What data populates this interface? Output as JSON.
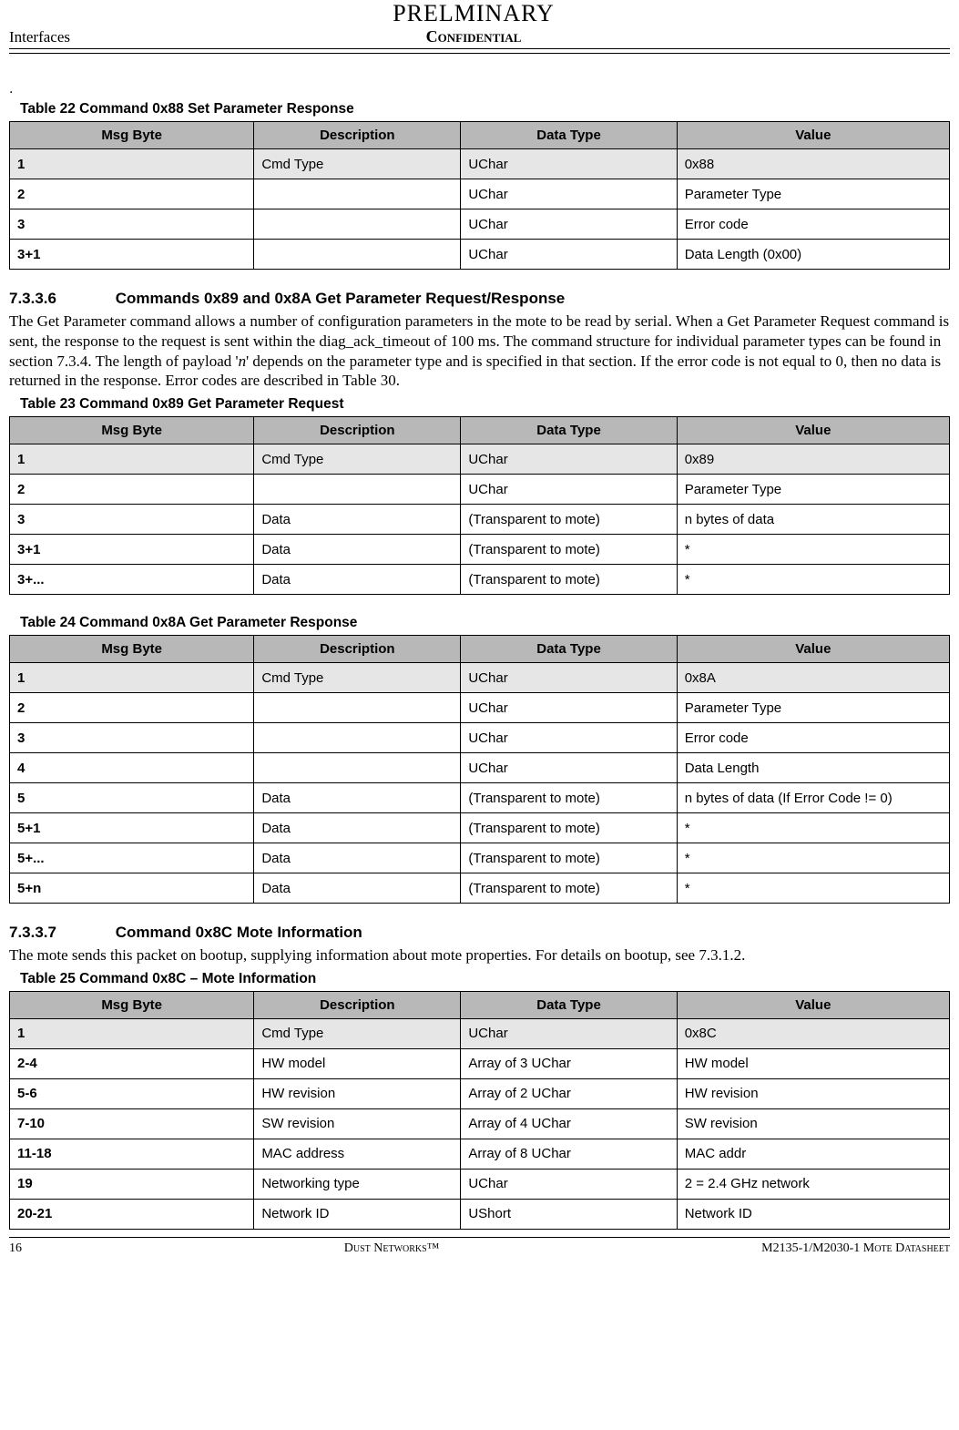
{
  "header": {
    "preliminary": "PRELMINARY",
    "confidential": "Confidential",
    "section": "Interfaces"
  },
  "table22": {
    "caption": "Table 22    Command 0x88 Set Parameter Response",
    "headers": [
      "Msg Byte",
      "Description",
      "Data Type",
      "Value"
    ],
    "rows": [
      {
        "byte": "1",
        "desc": "Cmd Type",
        "type": "UChar",
        "val": "0x88",
        "shaded": true
      },
      {
        "byte": "2",
        "desc": "",
        "type": "UChar",
        "val": "Parameter Type",
        "shaded": false
      },
      {
        "byte": "3",
        "desc": "",
        "type": "UChar",
        "val": "Error code",
        "shaded": false
      },
      {
        "byte": "3+1",
        "desc": "",
        "type": "UChar",
        "val": "Data Length (0x00)",
        "shaded": false
      }
    ]
  },
  "sec7336": {
    "num": "7.3.3.6",
    "title": "Commands 0x89 and 0x8A Get Parameter Request/Response",
    "body": "The Get Parameter command allows a number of configuration parameters in the mote to be read by serial. When a Get Parameter Request command is sent, the response to the request is sent within the diag_ack_timeout of 100 ms. The command structure for individual parameter types can be found in section 7.3.4. The length of payload 'n' depends on the parameter type and is specified in that section. If the error code is not equal to 0, then no data is returned in the response. Error codes are described in Table 30."
  },
  "table23": {
    "caption": "Table 23    Command 0x89 Get Parameter Request",
    "headers": [
      "Msg Byte",
      "Description",
      "Data Type",
      "Value"
    ],
    "rows": [
      {
        "byte": "1",
        "desc": "Cmd Type",
        "type": "UChar",
        "val": "0x89",
        "shaded": true
      },
      {
        "byte": "2",
        "desc": "",
        "type": "UChar",
        "val": "Parameter Type",
        "shaded": false
      },
      {
        "byte": "3",
        "desc": "Data",
        "type": "(Transparent to mote)",
        "val": "n bytes of data",
        "shaded": false
      },
      {
        "byte": "3+1",
        "desc": "Data",
        "type": "(Transparent to mote)",
        "val": "*",
        "shaded": false
      },
      {
        "byte": "3+...",
        "desc": "Data",
        "type": "(Transparent to mote)",
        "val": "*",
        "shaded": false
      }
    ]
  },
  "table24": {
    "caption": "Table 24    Command 0x8A Get Parameter Response",
    "headers": [
      "Msg Byte",
      "Description",
      "Data Type",
      "Value"
    ],
    "rows": [
      {
        "byte": "1",
        "desc": "Cmd Type",
        "type": "UChar",
        "val": "0x8A",
        "shaded": true
      },
      {
        "byte": "2",
        "desc": "",
        "type": "UChar",
        "val": "Parameter Type",
        "shaded": false
      },
      {
        "byte": "3",
        "desc": "",
        "type": "UChar",
        "val": "Error code",
        "shaded": false
      },
      {
        "byte": "4",
        "desc": "",
        "type": "UChar",
        "val": "Data Length",
        "shaded": false
      },
      {
        "byte": "5",
        "desc": "Data",
        "type": "(Transparent to mote)",
        "val": "n bytes of data (If Error Code != 0)",
        "shaded": false,
        "small": true
      },
      {
        "byte": "5+1",
        "desc": "Data",
        "type": "(Transparent to mote)",
        "val": "*",
        "shaded": false
      },
      {
        "byte": "5+...",
        "desc": "Data",
        "type": "(Transparent to mote)",
        "val": "*",
        "shaded": false
      },
      {
        "byte": "5+n",
        "desc": "Data",
        "type": "(Transparent to mote)",
        "val": "*",
        "shaded": false
      }
    ]
  },
  "sec7337": {
    "num": "7.3.3.7",
    "title": "Command 0x8C Mote Information",
    "body": "The mote sends this packet on bootup, supplying information about mote properties. For details on bootup, see 7.3.1.2."
  },
  "table25": {
    "caption": "Table 25    Command 0x8C – Mote Information",
    "headers": [
      "Msg Byte",
      "Description",
      "Data Type",
      "Value"
    ],
    "rows": [
      {
        "byte": "1",
        "desc": "Cmd Type",
        "type": "UChar",
        "val": "0x8C",
        "shaded": true
      },
      {
        "byte": "2-4",
        "desc": "HW model",
        "type": "Array of 3 UChar",
        "val": "HW model",
        "shaded": false
      },
      {
        "byte": "5-6",
        "desc": "HW revision",
        "type": "Array of 2 UChar",
        "val": "HW revision",
        "shaded": false
      },
      {
        "byte": "7-10",
        "desc": "SW revision",
        "type": "Array of 4 UChar",
        "val": "SW revision",
        "shaded": false
      },
      {
        "byte": "11-18",
        "desc": "MAC address",
        "type": "Array of 8 UChar",
        "val": "MAC addr",
        "shaded": false
      },
      {
        "byte": "19",
        "desc": "Networking type",
        "type": "UChar",
        "val": "2 = 2.4 GHz network",
        "shaded": false
      },
      {
        "byte": "20-21",
        "desc": "Network ID",
        "type": "UShort",
        "val": "Network ID",
        "shaded": false
      }
    ]
  },
  "footer": {
    "page": "16",
    "mid": "Dust Networks™",
    "right": "M2135-1/M2030-1 Mote Datasheet"
  }
}
